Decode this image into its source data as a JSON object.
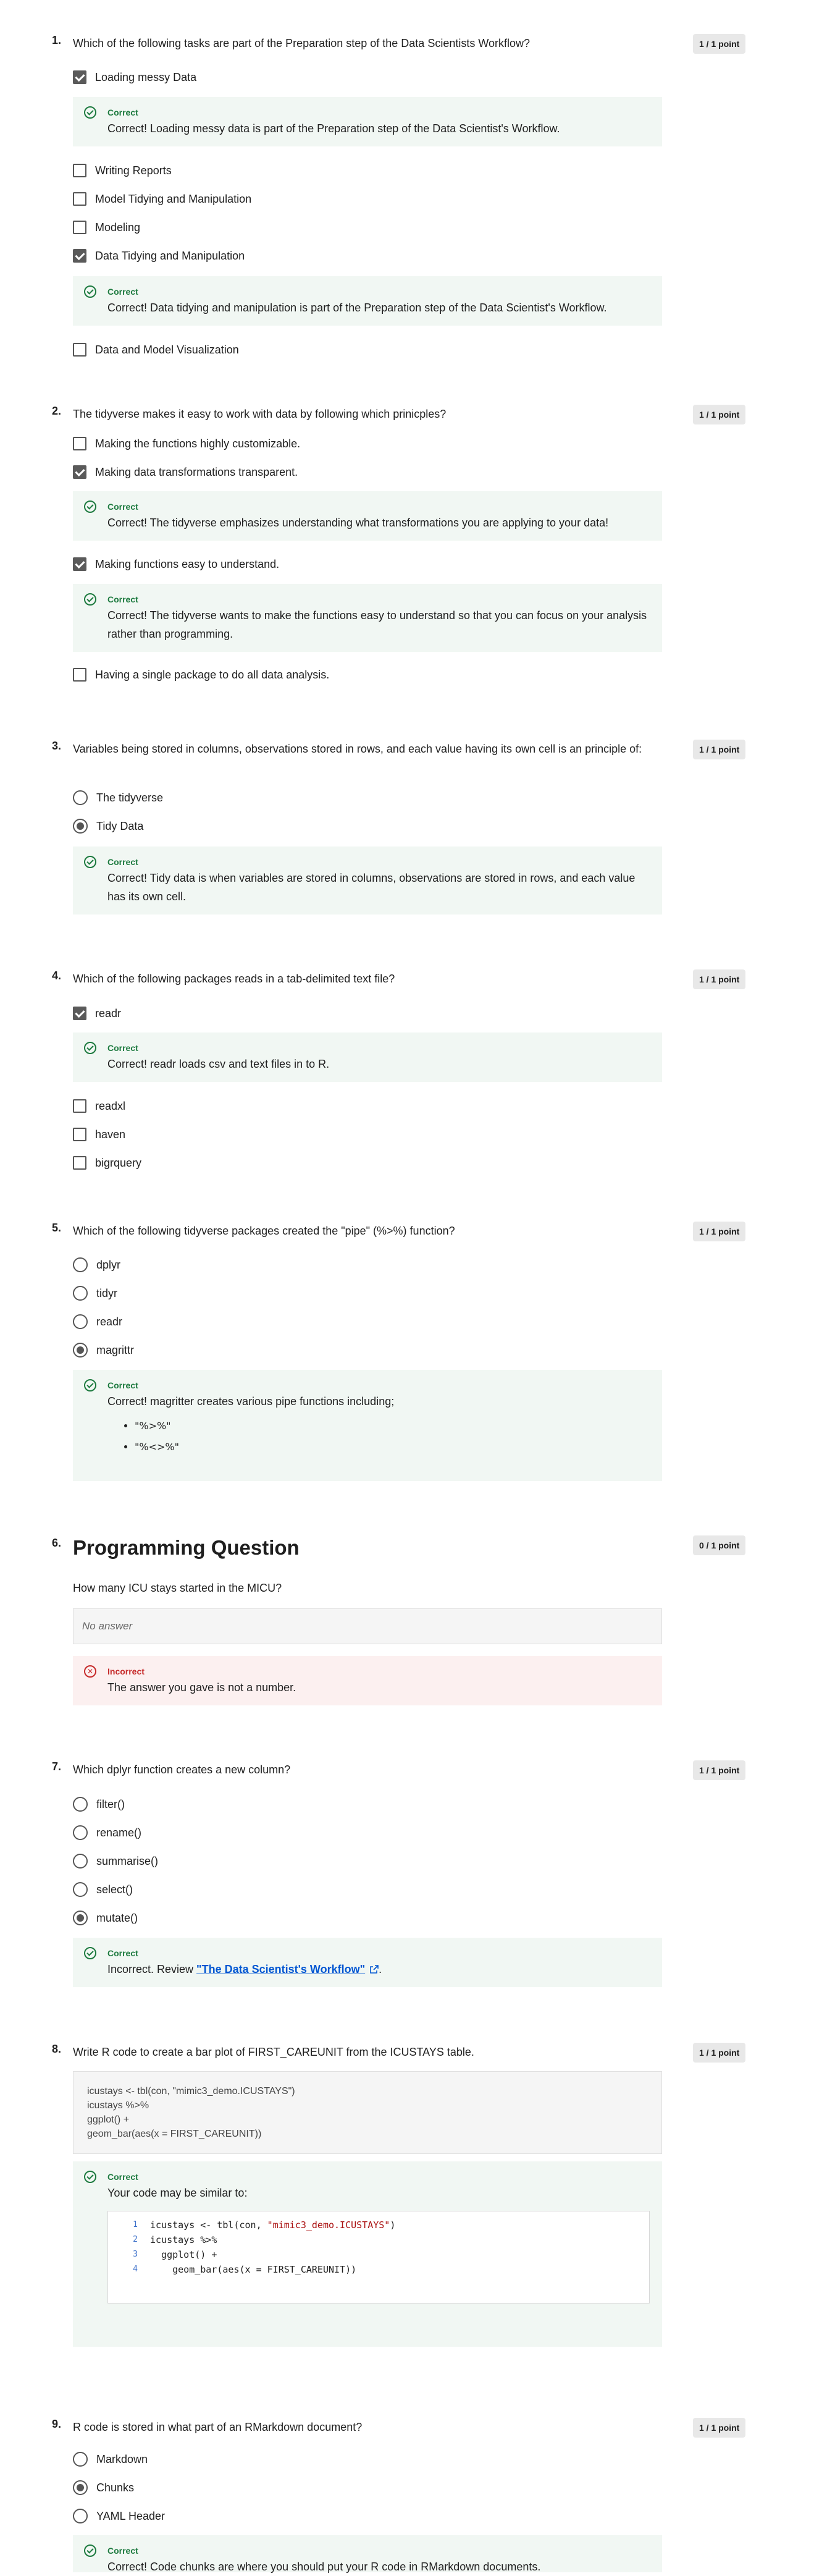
{
  "colors": {
    "correct": "#1d7a3f",
    "incorrect": "#c62b2b",
    "link": "#0056d2",
    "points_bg": "#e8e8e8"
  },
  "feedback_labels": {
    "correct": "Correct",
    "incorrect": "Incorrect"
  },
  "questions": [
    {
      "number": "1.",
      "points": "1 / 1 point",
      "text": "Which of the following tasks are part of the Preparation step of the Data Scientists Workflow?",
      "options": [
        {
          "label": "Loading messy Data",
          "checked": true,
          "feedback": "Correct! Loading messy data is part of the Preparation step of the Data Scientist's Workflow."
        },
        {
          "label": "Writing Reports",
          "checked": false
        },
        {
          "label": "Model Tidying and Manipulation",
          "checked": false
        },
        {
          "label": "Modeling",
          "checked": false
        },
        {
          "label": "Data Tidying and Manipulation",
          "checked": true,
          "feedback": "Correct! Data tidying and manipulation is part of the Preparation step of the Data Scientist's Workflow."
        },
        {
          "label": "Data and Model Visualization",
          "checked": false
        }
      ]
    },
    {
      "number": "2.",
      "points": "1 / 1 point",
      "text": "The tidyverse makes it easy to work with data by following which prinicples?",
      "options": [
        {
          "label": "Making the functions highly customizable.",
          "checked": false
        },
        {
          "label": "Making data transformations transparent.",
          "checked": true,
          "feedback": "Correct! The tidyverse emphasizes understanding what transformations you are applying to your data!"
        },
        {
          "label": "Making functions easy to understand.",
          "checked": true,
          "feedback": "Correct! The tidyverse wants to make the functions easy to understand so that you can focus on your analysis rather than programming."
        },
        {
          "label": "Having a single package to do all data analysis.",
          "checked": false
        }
      ]
    },
    {
      "number": "3.",
      "points": "1 / 1 point",
      "text": "Variables being stored in columns, observations stored in rows, and each value having its own cell is an principle of:",
      "options": [
        {
          "label": "The tidyverse",
          "checked": false
        },
        {
          "label": "Tidy Data",
          "checked": true
        }
      ],
      "feedback": "Correct! Tidy data is when variables are stored in columns, observations are stored in rows, and each value has its own cell."
    },
    {
      "number": "4.",
      "points": "1 / 1 point",
      "text": "Which of the following packages reads in a tab-delimited text file?",
      "options": [
        {
          "label": "readr",
          "checked": true,
          "feedback": "Correct! readr loads csv and text files in to R."
        },
        {
          "label": "readxl",
          "checked": false
        },
        {
          "label": "haven",
          "checked": false
        },
        {
          "label": "bigrquery",
          "checked": false
        }
      ]
    },
    {
      "number": "5.",
      "points": "1 / 1 point",
      "text": "Which of the following tidyverse packages created the \"pipe\" (%>%) function?",
      "options": [
        {
          "label": "dplyr",
          "checked": false
        },
        {
          "label": "tidyr",
          "checked": false
        },
        {
          "label": "readr",
          "checked": false
        },
        {
          "label": "magrittr",
          "checked": true
        }
      ],
      "feedback": "Correct! magritter creates various pipe functions including;",
      "bullets": [
        "\"%>%\"",
        "\"%<>%\""
      ]
    },
    {
      "number": "6.",
      "points": "0 / 1 point",
      "heading": "Programming Question",
      "text": "How many ICU stays started in the MICU?",
      "answer_placeholder": "No answer",
      "feedback": "The answer you gave is not a number."
    },
    {
      "number": "7.",
      "points": "1 / 1 point",
      "text": "Which dplyr function creates a new column?",
      "options": [
        {
          "label": "filter()",
          "checked": false
        },
        {
          "label": "rename()",
          "checked": false
        },
        {
          "label": "summarise()",
          "checked": false
        },
        {
          "label": "select()",
          "checked": false
        },
        {
          "label": "mutate()",
          "checked": true
        }
      ],
      "feedback_prefix": "Incorrect. Review ",
      "feedback_link": "\"The Data Scientist's Workflow\"",
      "feedback_suffix": "."
    },
    {
      "number": "8.",
      "points": "1 / 1 point",
      "text": "Write R code to create a bar plot of FIRST_CAREUNIT from the ICUSTAYS table.",
      "answer_lines": [
        "icustays <- tbl(con, \"mimic3_demo.ICUSTAYS\")",
        "icustays %>%",
        "ggplot() +",
        "geom_bar(aes(x = FIRST_CAREUNIT))"
      ],
      "feedback": "Your code may be similar to:",
      "code": [
        {
          "n": "1",
          "pre": "icustays <- tbl(con, ",
          "str": "\"mimic3_demo.ICUSTAYS\"",
          "post": ")"
        },
        {
          "n": "2",
          "pre": "icustays %>%",
          "str": "",
          "post": ""
        },
        {
          "n": "3",
          "pre": "  ggplot() +",
          "str": "",
          "post": ""
        },
        {
          "n": "4",
          "pre": "    geom_bar(aes(x = FIRST_CAREUNIT))",
          "str": "",
          "post": ""
        }
      ]
    },
    {
      "number": "9.",
      "points": "1 / 1 point",
      "text": "R code is stored in what part of an RMarkdown document?",
      "options": [
        {
          "label": "Markdown",
          "checked": false
        },
        {
          "label": "Chunks",
          "checked": true
        },
        {
          "label": "YAML Header",
          "checked": false
        }
      ],
      "feedback": "Correct! Code chunks are where you should put your R code in RMarkdown documents."
    }
  ]
}
